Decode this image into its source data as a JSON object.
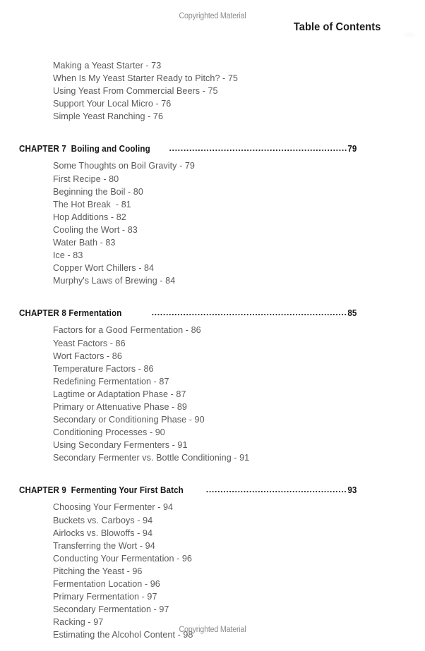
{
  "running_head": "Copyrighted Material",
  "running_foot": "Copyrighted Material",
  "page_title": "Table of Contents",
  "leader_dots": "........................................................................................................................................................",
  "sections": [
    {
      "chapter": null,
      "entries": [
        "Making a Yeast Starter - 73",
        "When Is My Yeast Starter Ready to Pitch? - 75",
        "Using Yeast From Commercial Beers - 75",
        "Support Your Local Micro - 76",
        "Simple Yeast Ranching - 76"
      ]
    },
    {
      "chapter": {
        "label": "CHAPTER 7  Boiling and Cooling",
        "gap": 6,
        "page": "79"
      },
      "entries": [
        "Some Thoughts on Boil Gravity - 79",
        "First Recipe - 80",
        "Beginning the Boil - 80",
        "The Hot Break  - 81",
        "Hop Additions - 82",
        "Cooling the Wort - 83",
        "Water Bath - 83",
        "Ice - 83",
        "Copper Wort Chillers - 84",
        "Murphy's Laws of Brewing - 84"
      ]
    },
    {
      "chapter": {
        "label": "CHAPTER 8 Fermentation",
        "gap": 26,
        "page": "85"
      },
      "entries": [
        "Factors for a Good Fermentation - 86",
        "Yeast Factors - 86",
        "Wort Factors - 86",
        "Temperature Factors - 86",
        "Redefining Fermentation - 87",
        "Lagtime or Adaptation Phase - 87",
        "Primary or Attenuative Phase - 89",
        "Secondary or Conditioning Phase - 90",
        "Conditioning Processes - 90",
        "Using Secondary Fermenters - 91",
        "Secondary Fermenter vs. Bottle Conditioning - 91"
      ]
    },
    {
      "chapter": {
        "label": "CHAPTER 9  Fermenting Your First Batch",
        "gap": 6,
        "page": "93"
      },
      "entries": [
        "Choosing Your Fermenter - 94",
        "Buckets vs. Carboys - 94",
        "Airlocks vs. Blowoffs - 94",
        "Transferring the Wort - 94",
        "Conducting Your Fermentation - 96",
        "Pitching the Yeast - 96",
        "Fermentation Location - 96",
        "Primary Fermentation - 97",
        "Secondary Fermentation - 97",
        "Racking - 97",
        "Estimating the Alcohol Content - 98"
      ]
    }
  ]
}
